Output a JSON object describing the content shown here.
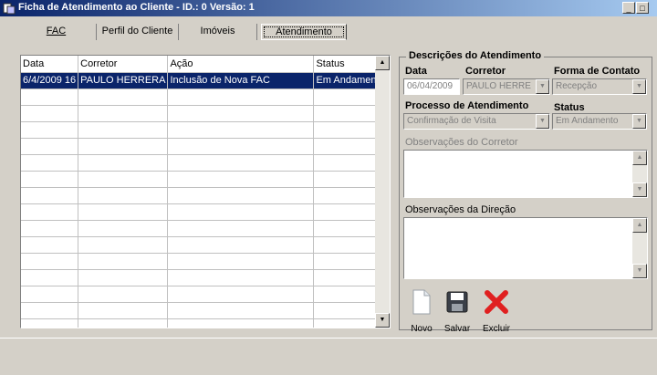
{
  "window": {
    "title": "Ficha de Atendimento ao Cliente - ID.: 0 Versão: 1",
    "min_glyph": "_",
    "max_glyph": "□"
  },
  "tabs": [
    {
      "label": "FAC"
    },
    {
      "label": "Perfil do Cliente"
    },
    {
      "label": "Imóveis"
    },
    {
      "label": "Atendimento"
    }
  ],
  "grid": {
    "columns": [
      "Data",
      "Corretor",
      "Ação",
      "Status"
    ],
    "rows": [
      {
        "data": "6/4/2009 16",
        "corretor": "PAULO HERRERA",
        "acao": "Inclusão de Nova FAC",
        "status": "Em Andamento"
      }
    ]
  },
  "details": {
    "group_title": "Descrições do Atendimento",
    "data_label": "Data",
    "corretor_label": "Corretor",
    "forma_label": "Forma de Contato",
    "data_value": "06/04/2009",
    "corretor_value": "PAULO HERRE",
    "forma_value": "Recepção",
    "processo_label": "Processo de Atendimento",
    "status_label": "Status",
    "processo_value": "Confirmação de Visita",
    "status_value": "Em Andamento",
    "obs_corretor_label": "Observações do Corretor",
    "obs_direcao_label": "Observações da Direção"
  },
  "toolbar": {
    "novo": "Novo",
    "salvar": "Salvar",
    "excluir": "Excluir"
  },
  "icons": [
    "app-icon",
    "new-document-icon",
    "floppy-disk-icon",
    "delete-x-icon",
    "scroll-up-arrow-icon",
    "scroll-down-arrow-icon",
    "dropdown-arrow-icon"
  ],
  "colors": {
    "selection": "#0a246a",
    "delete_red": "#e02020",
    "face": "#d4d0c8"
  }
}
